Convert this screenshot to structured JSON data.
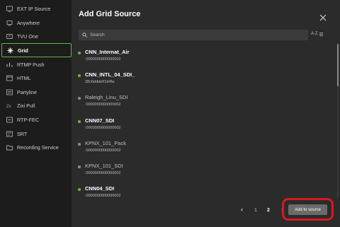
{
  "sidebar": {
    "items": [
      {
        "label": "EXT IP Source",
        "icon": "ext-ip-icon"
      },
      {
        "label": "Anywhere",
        "icon": "anywhere-icon"
      },
      {
        "label": "TVU One",
        "icon": "tvu-one-icon"
      },
      {
        "label": "Grid",
        "icon": "grid-icon",
        "active": true
      },
      {
        "label": "RTMP Push",
        "icon": "rtmp-icon"
      },
      {
        "label": "HTML",
        "icon": "html-icon"
      },
      {
        "label": "Partyline",
        "icon": "partyline-icon"
      },
      {
        "label": "Zixi Pull",
        "icon": "zixi-icon"
      },
      {
        "label": "RTP-FEC",
        "icon": "rtp-fec-icon"
      },
      {
        "label": "SRT",
        "icon": "srt-icon"
      },
      {
        "label": "Recording Service",
        "icon": "folder-icon"
      }
    ]
  },
  "modal": {
    "title": "Add Grid Source",
    "search_placeholder": "Search",
    "sort_label": "A-Z",
    "add_button_label": "Add to source"
  },
  "sources": [
    {
      "name": "CNN_Internat_Air",
      "id": ":0000000000000002",
      "status": "online"
    },
    {
      "name": "CNN_INTL_04_SDI_",
      "id": "28c6ddde91d4fa:",
      "status": "online"
    },
    {
      "name": "Raleigh_Linu_SDI",
      "id": ":0000000000000002",
      "status": "offline"
    },
    {
      "name": "CNN07_SDI",
      "id": ":0000000000000002",
      "status": "online"
    },
    {
      "name": "KPNX_101_Pack",
      "id": ":0000000000000002",
      "status": "offline"
    },
    {
      "name": "KPNX_101_SDI",
      "id": ":0000000000000002",
      "status": "offline"
    },
    {
      "name": "CNN04_SDI",
      "id": ":0000000000000002",
      "status": "online"
    }
  ],
  "pagination": {
    "prev": "‹",
    "pages": [
      "1",
      "2"
    ],
    "current": "1",
    "next": "›"
  },
  "colors": {
    "online": "#5fb83a",
    "offline": "#8c8c8c",
    "accent": "#5fb83a",
    "highlight": "#d71920"
  }
}
